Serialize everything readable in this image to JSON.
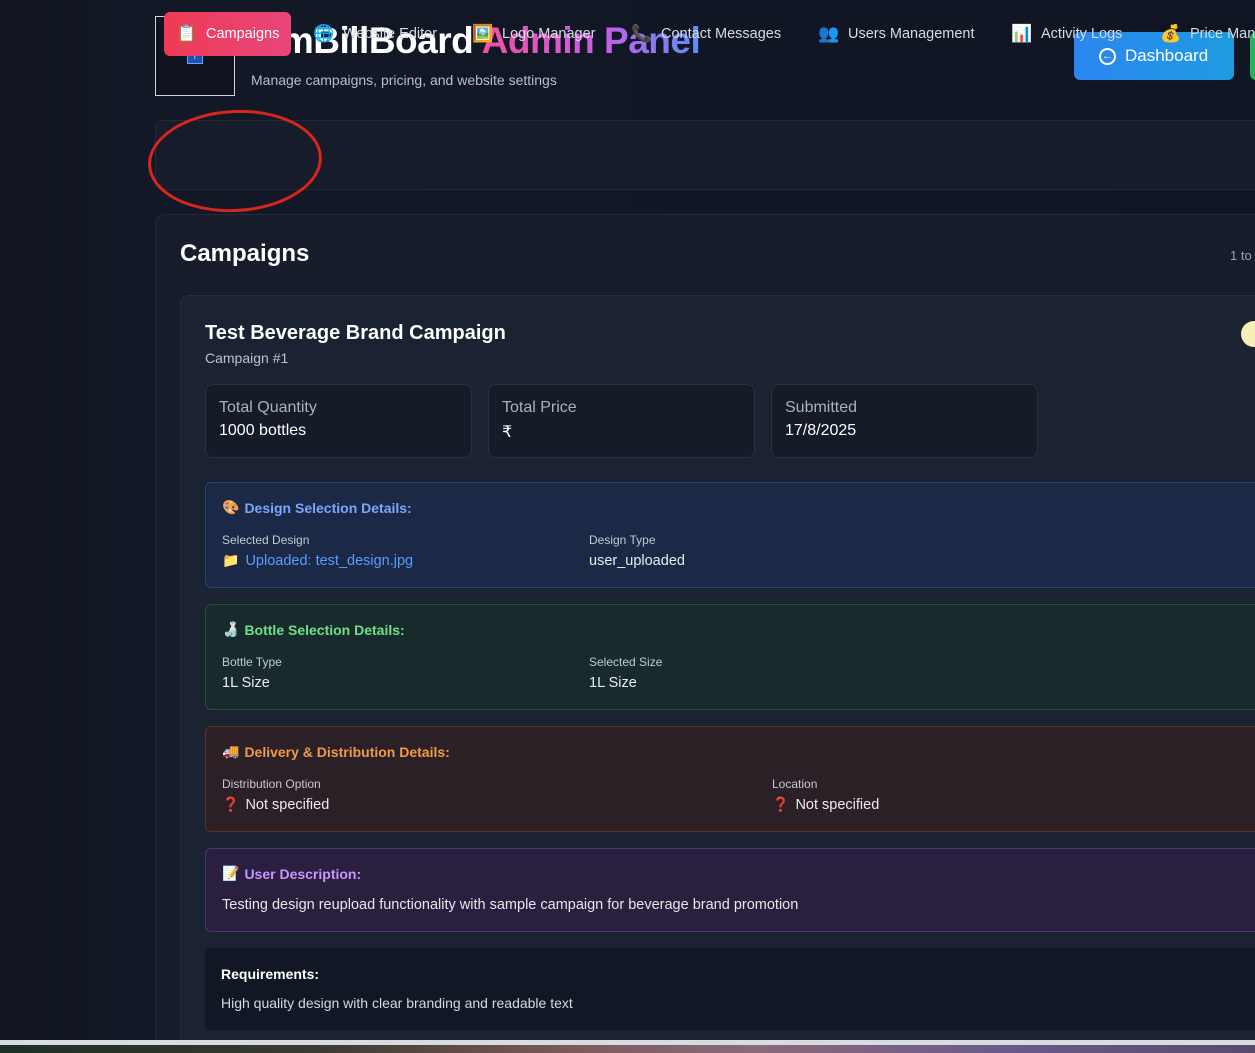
{
  "header": {
    "brand_part1": "IamBillBoard",
    "brand_part2": "Admin Panel",
    "tagline": "Manage campaigns, pricing, and website settings",
    "logo_icon": "broken-image-icon",
    "dashboard_label": "Dashboard"
  },
  "tabs": [
    {
      "label": "Campaigns",
      "icon": "📋",
      "active": true
    },
    {
      "label": "Website Editor",
      "icon": "🌐"
    },
    {
      "label": "Logo Manager",
      "icon": "🖼️"
    },
    {
      "label": "Contact Messages",
      "icon": "📞"
    },
    {
      "label": "Users Management",
      "icon": "👥"
    },
    {
      "label": "Activity Logs",
      "icon": "📊"
    },
    {
      "label": "Price Man",
      "icon": "💰"
    }
  ],
  "panel": {
    "title": "Campaigns",
    "count": "1 to"
  },
  "campaign": {
    "title": "Test Beverage Brand Campaign",
    "number": "Campaign #1",
    "stats": [
      {
        "label": "Total Quantity",
        "value": "1000 bottles"
      },
      {
        "label": "Total Price",
        "value": "₹"
      },
      {
        "label": "Submitted",
        "value": "17/8/2025"
      }
    ],
    "design": {
      "icon": "🎨",
      "heading": "Design Selection Details:",
      "selected_label": "Selected Design",
      "selected_icon": "📁",
      "selected_value": "Uploaded: test_design.jpg",
      "type_label": "Design Type",
      "type_value": "user_uploaded"
    },
    "bottle": {
      "icon": "🍶",
      "heading": "Bottle Selection Details:",
      "type_label": "Bottle Type",
      "type_value": "1L Size",
      "size_label": "Selected Size",
      "size_value": "1L Size"
    },
    "delivery": {
      "icon": "🚚",
      "heading": "Delivery & Distribution Details:",
      "option_label": "Distribution Option",
      "option_value": "Not specified",
      "location_label": "Location",
      "location_value": "Not specified",
      "missing_icon": "❓"
    },
    "user_description": {
      "icon": "📝",
      "heading": "User Description:",
      "text": "Testing design reupload functionality with sample campaign for beverage brand promotion"
    },
    "requirements": {
      "heading": "Requirements:",
      "text": "High quality design with clear branding and readable text"
    }
  },
  "colors": {
    "active_tab": "#ef3b55",
    "dashboard_button": "#2b86f0",
    "annotation": "#d6261d"
  }
}
